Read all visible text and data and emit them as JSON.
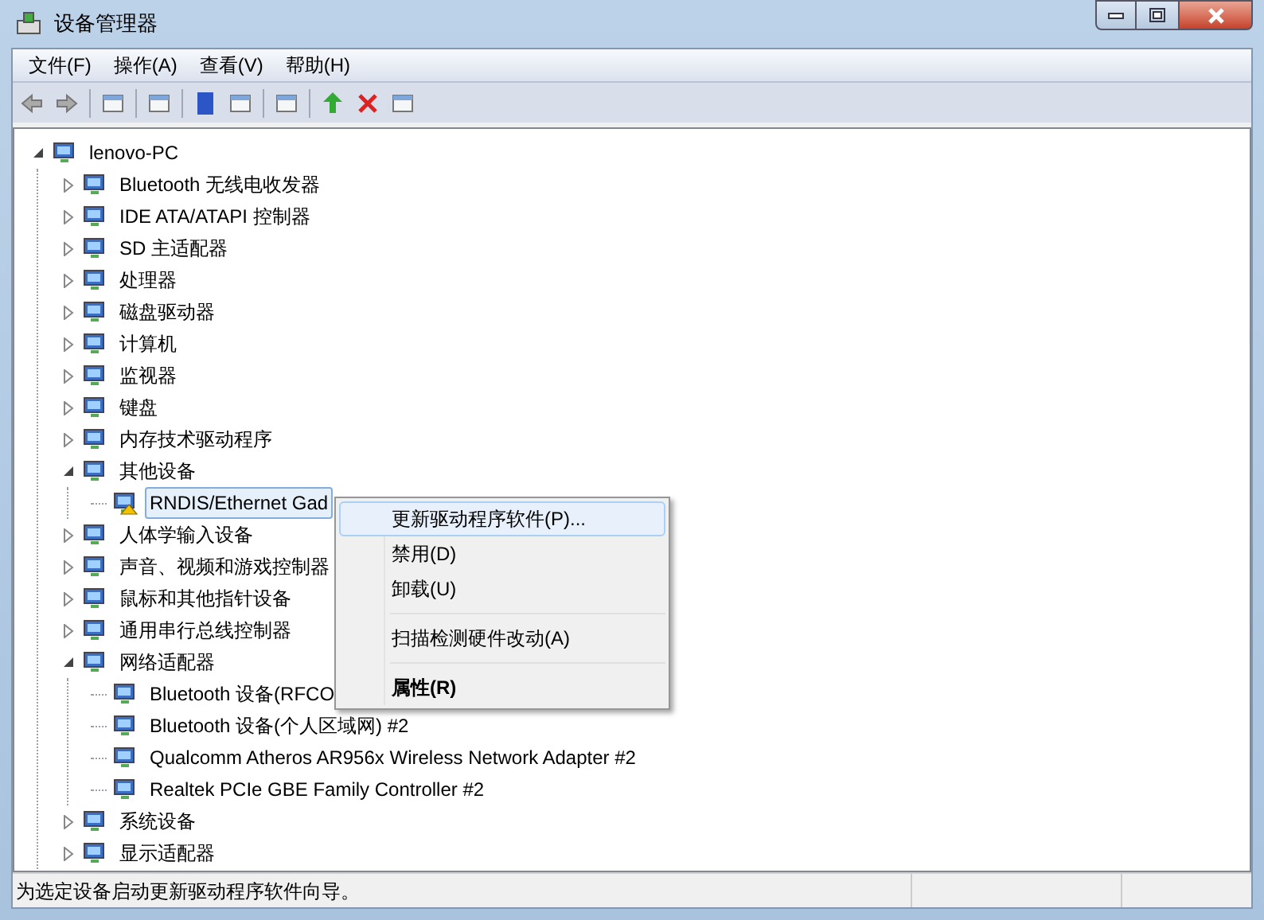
{
  "window": {
    "title": "设备管理器"
  },
  "menu_bar": [
    "文件(F)",
    "操作(A)",
    "查看(V)",
    "帮助(H)"
  ],
  "tree": [
    {
      "label": "lenovo-PC",
      "expanded": true,
      "selected": false,
      "children": [
        {
          "label": "Bluetooth 无线电收发器",
          "expanded": false,
          "selected": false
        },
        {
          "label": "IDE ATA/ATAPI 控制器",
          "expanded": false,
          "selected": false
        },
        {
          "label": "SD 主适配器",
          "expanded": false,
          "selected": false
        },
        {
          "label": "处理器",
          "expanded": false,
          "selected": false
        },
        {
          "label": "磁盘驱动器",
          "expanded": false,
          "selected": false
        },
        {
          "label": "计算机",
          "expanded": false,
          "selected": false
        },
        {
          "label": "监视器",
          "expanded": false,
          "selected": false
        },
        {
          "label": "键盘",
          "expanded": false,
          "selected": false
        },
        {
          "label": "内存技术驱动程序",
          "expanded": false,
          "selected": false
        },
        {
          "label": "其他设备",
          "expanded": true,
          "selected": false,
          "children": [
            {
              "label": "RNDIS/Ethernet Gad",
              "selected": true,
              "warning": true
            }
          ]
        },
        {
          "label": "人体学输入设备",
          "expanded": false,
          "selected": false
        },
        {
          "label": "声音、视频和游戏控制器",
          "expanded": false,
          "selected": false
        },
        {
          "label": "鼠标和其他指针设备",
          "expanded": false,
          "selected": false
        },
        {
          "label": "通用串行总线控制器",
          "expanded": false,
          "selected": false
        },
        {
          "label": "网络适配器",
          "expanded": true,
          "selected": false,
          "children": [
            {
              "label": "Bluetooth 设备(RFCO",
              "selected": false,
              "warning": false
            },
            {
              "label": "Bluetooth 设备(个人区域网) #2",
              "selected": false,
              "warning": false
            },
            {
              "label": "Qualcomm Atheros AR956x Wireless Network Adapter #2",
              "selected": false,
              "warning": false
            },
            {
              "label": "Realtek PCIe GBE Family Controller #2",
              "selected": false,
              "warning": false
            }
          ]
        },
        {
          "label": "系统设备",
          "expanded": false,
          "selected": false
        },
        {
          "label": "显示适配器",
          "expanded": false,
          "selected": false
        }
      ]
    }
  ],
  "context_menu": [
    {
      "kind": "item",
      "label": "更新驱动程序软件(P)...",
      "selected": true,
      "bold": false
    },
    {
      "kind": "item",
      "label": "禁用(D)",
      "selected": false,
      "bold": false
    },
    {
      "kind": "item",
      "label": "卸载(U)",
      "selected": false,
      "bold": false
    },
    {
      "kind": "separator"
    },
    {
      "kind": "item",
      "label": "扫描检测硬件改动(A)",
      "selected": false,
      "bold": false
    },
    {
      "kind": "separator"
    },
    {
      "kind": "item",
      "label": "属性(R)",
      "selected": false,
      "bold": true
    }
  ],
  "status_bar": {
    "text": "为选定设备启动更新驱动程序软件向导。"
  }
}
